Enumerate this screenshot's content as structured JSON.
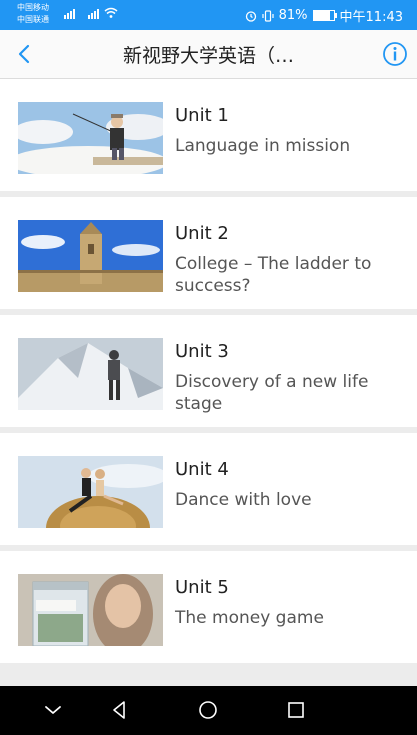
{
  "status_bar": {
    "carrier_1": "中国移动",
    "carrier_2": "中国联通",
    "sim1_tag": "2G",
    "sim2_tag": "4G",
    "battery_percent": "81%",
    "battery_level": 0.81,
    "time": "中午11:43"
  },
  "header": {
    "title": "新视野大学英语（…",
    "back_icon": "chevron-left-icon",
    "info_icon": "info-icon",
    "accent_color": "#2196f3"
  },
  "units": [
    {
      "title": "Unit 1",
      "subtitle": "Language in mission",
      "image": "man-fishing-on-clouds-photo"
    },
    {
      "title": "Unit 2",
      "subtitle": "College – The ladder to success?",
      "image": "college-tower-photo"
    },
    {
      "title": "Unit 3",
      "subtitle": "Discovery of a new life stage",
      "image": "mountain-climber-photo"
    },
    {
      "title": "Unit 4",
      "subtitle": "Dance with love",
      "image": "couple-on-haybale-photo"
    },
    {
      "title": "Unit 5",
      "subtitle": "The money game",
      "image": "college-jar-money-photo"
    }
  ],
  "nav_bar": {
    "icons": [
      "collapse-icon",
      "back-triangle-icon",
      "home-circle-icon",
      "recents-square-icon"
    ]
  }
}
